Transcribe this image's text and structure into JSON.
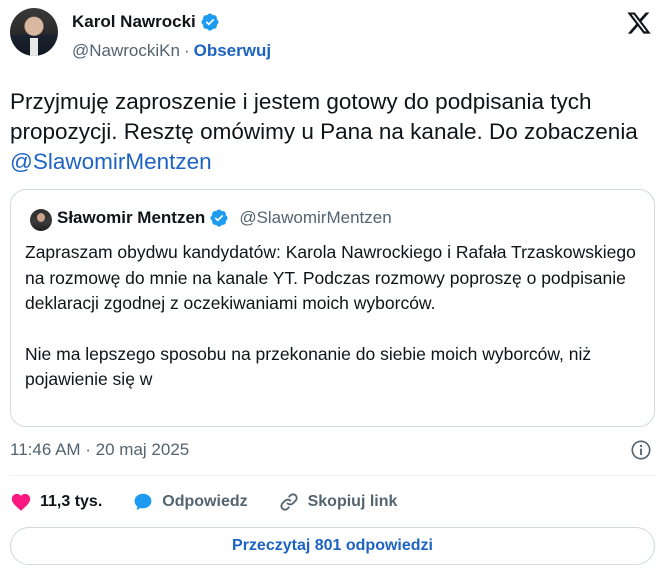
{
  "author": {
    "name": "Karol Nawrocki",
    "handle": "@NawrockiKn",
    "separator": "·",
    "follow_label": "Obserwuj"
  },
  "tweet": {
    "text_before_mention": "Przyjmuję zaproszenie i jestem gotowy do podpisania tych propozycji. Resztę omówimy u Pana na kanale. Do zobaczenia ",
    "mention": "@SlawomirMentzen"
  },
  "quoted": {
    "name": "Sławomir Mentzen",
    "handle": "@SlawomirMentzen",
    "paragraph_1": "Zapraszam obydwu kandydatów: Karola Nawrockiego i Rafała Trzaskowskiego na rozmowę do mnie na kanale YT. Podczas rozmowy poproszę o podpisanie deklaracji zgodnej z oczekiwaniami moich wyborców.",
    "paragraph_2": "Nie ma lepszego sposobu na przekonanie do siebie moich wyborców, niż pojawienie się w"
  },
  "meta": {
    "timestamp": "11:46 AM · 20 maj 2025"
  },
  "actions": {
    "likes": "11,3 tys.",
    "reply_label": "Odpowiedz",
    "copy_link_label": "Skopiuj link"
  },
  "replies_button": "Przeczytaj 801 odpowiedzi",
  "colors": {
    "accent": "#1d64c2",
    "verified": "#1d9bf0",
    "like": "#f91880",
    "secondary_text": "#536471",
    "border": "#cfd9de"
  },
  "icons": {
    "verified": "verified-badge-icon",
    "x_logo": "x-logo-icon",
    "info": "info-icon",
    "like": "heart-icon",
    "reply": "speech-bubble-icon",
    "copy_link": "link-icon"
  }
}
